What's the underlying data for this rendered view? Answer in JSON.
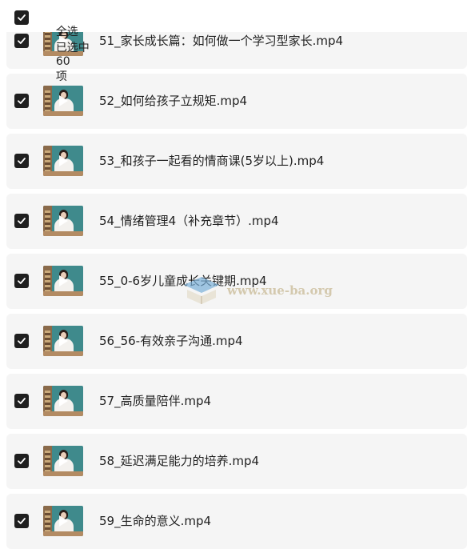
{
  "header": {
    "select_all_label": "全选",
    "selected_prefix": "已选中",
    "selected_count": "60",
    "selected_suffix": "项",
    "checked": true
  },
  "files": [
    {
      "name": "51_家长成长篇：如何做一个学习型家长.mp4",
      "checked": true
    },
    {
      "name": "52_如何给孩子立规矩.mp4",
      "checked": true
    },
    {
      "name": "53_和孩子一起看的情商课(5岁以上).mp4",
      "checked": true
    },
    {
      "name": "54_情绪管理4（补充章节）.mp4",
      "checked": true
    },
    {
      "name": "55_0-6岁儿童成长关键期.mp4",
      "checked": true
    },
    {
      "name": "56_56-有效亲子沟通.mp4",
      "checked": true
    },
    {
      "name": "57_高质量陪伴.mp4",
      "checked": true
    },
    {
      "name": "58_延迟满足能力的培养.mp4",
      "checked": true
    },
    {
      "name": "59_生命的意义.mp4",
      "checked": true
    }
  ],
  "watermark": {
    "text": "www.xue-ba.org"
  },
  "colors": {
    "checkbox": "#1f1f1f",
    "row_bg": "#f5f5f5",
    "watermark": "#c8b996"
  },
  "icons": {
    "checkbox": "checkmark-icon",
    "thumbnail_play": "play-icon"
  }
}
